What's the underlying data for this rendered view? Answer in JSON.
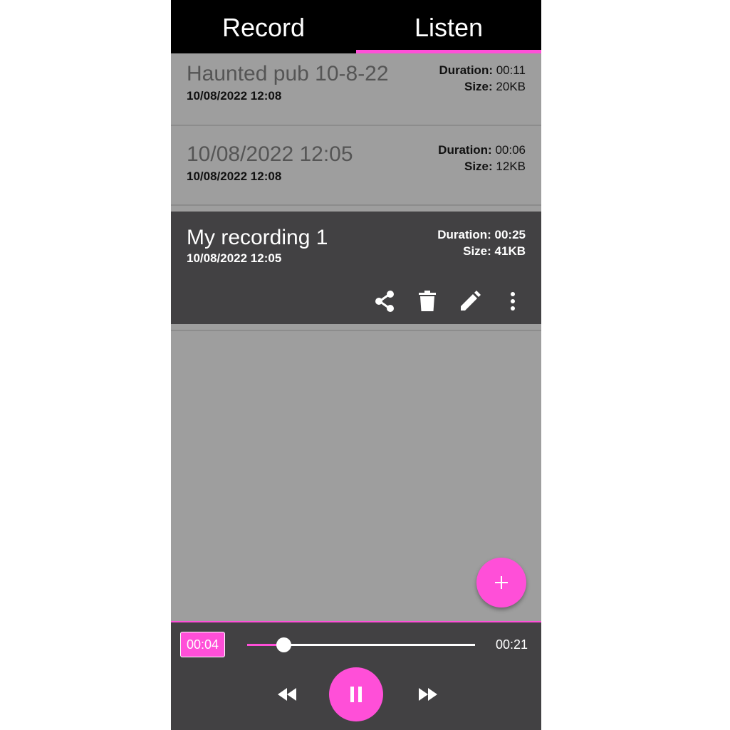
{
  "theme": {
    "accent": "#ff4fd8",
    "selected_bg": "#424143",
    "list_bg": "#9e9e9e",
    "tabbar_bg": "#000000"
  },
  "tabs": [
    {
      "label": "Record",
      "active": false
    },
    {
      "label": "Listen",
      "active": true
    }
  ],
  "recordings": [
    {
      "title": "Haunted pub 10-8-22",
      "date": "10/08/2022 12:08",
      "duration_label": "Duration:",
      "duration": "00:11",
      "size_label": "Size:",
      "size": "20KB"
    },
    {
      "title": "10/08/2022 12:05",
      "date": "10/08/2022 12:08",
      "duration_label": "Duration:",
      "duration": "00:06",
      "size_label": "Size:",
      "size": "12KB"
    },
    {
      "title": "My recording 1",
      "date": "10/08/2022 12:05",
      "duration_label": "Duration:",
      "duration": "00:25",
      "size_label": "Size:",
      "size": "41KB",
      "selected": true,
      "actions": [
        "share-icon",
        "delete-icon",
        "edit-icon",
        "more-vert-icon"
      ]
    }
  ],
  "fab": {
    "icon": "plus-icon"
  },
  "player": {
    "current_time": "00:04",
    "total_time": "00:21",
    "progress": 0.16,
    "state_icon": "pause-icon",
    "controls": [
      "rewind-icon",
      "pause-icon",
      "fast-forward-icon"
    ]
  }
}
